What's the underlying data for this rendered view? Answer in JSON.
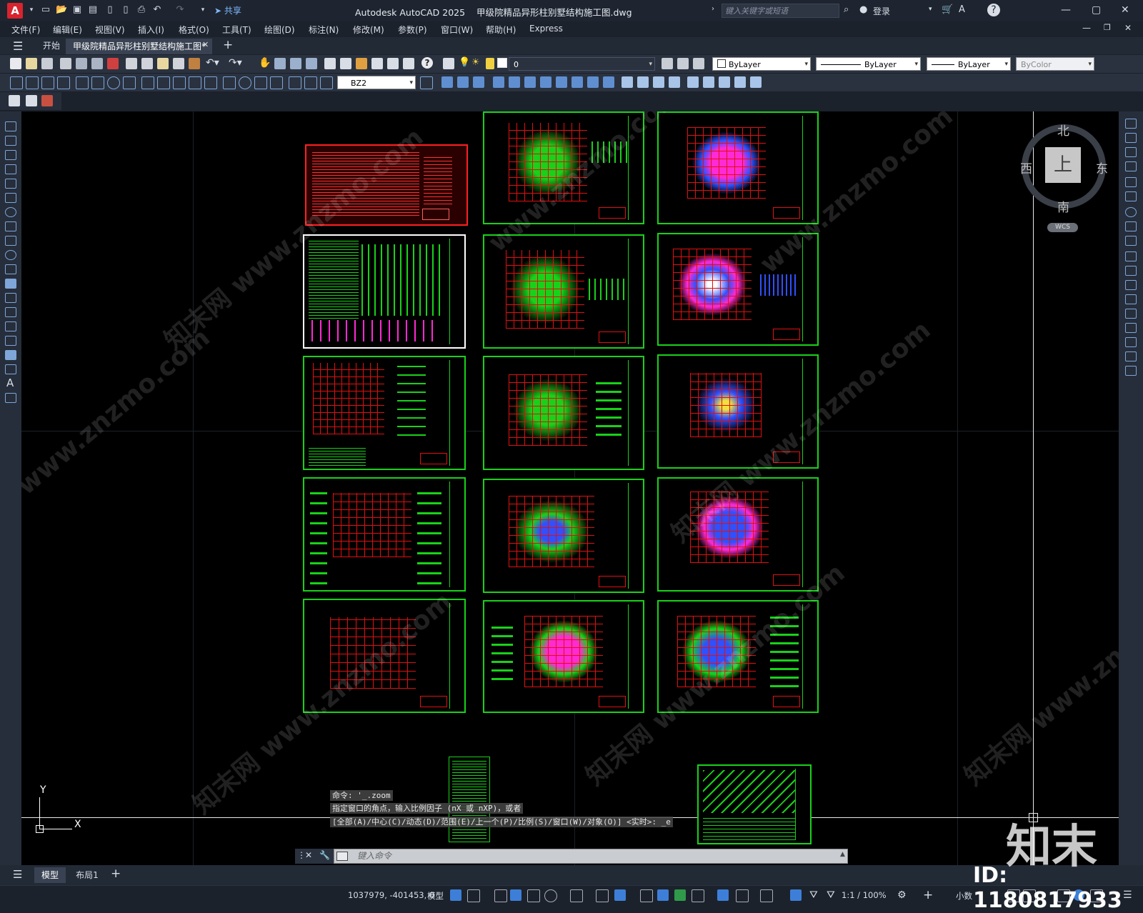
{
  "app": {
    "logo": "A",
    "name": "Autodesk AutoCAD 2025",
    "filename": "甲级院精品异形柱别墅结构施工图.dwg",
    "share_label": "共享",
    "search_placeholder": "键入关键字或短语",
    "login_label": "登录"
  },
  "menu": [
    "文件(F)",
    "编辑(E)",
    "视图(V)",
    "插入(I)",
    "格式(O)",
    "工具(T)",
    "绘图(D)",
    "标注(N)",
    "修改(M)",
    "参数(P)",
    "窗口(W)",
    "帮助(H)",
    "Express"
  ],
  "tabs": {
    "home": "开始",
    "doc": "甲级院精品异形柱别墅结构施工图*"
  },
  "layer_combo": "0",
  "dimstyle_combo": "BZ2",
  "properties": {
    "color": "ByLayer",
    "linetype": "ByLayer",
    "lineweight": "ByLayer",
    "plotstyle": "ByColor"
  },
  "viewcube": {
    "north": "北",
    "south": "南",
    "east": "东",
    "west": "西",
    "top": "上",
    "wcs": "WCS"
  },
  "ucs": {
    "y": "Y",
    "x": "X"
  },
  "command": {
    "history": [
      "命令: '_.zoom",
      "指定窗口的角点，输入比例因子 (nX 或 nXP)，或者",
      "[全部(A)/中心(C)/动态(D)/范围(E)/上一个(P)/比例(S)/窗口(W)/对象(O)] <实时>: _e"
    ],
    "placeholder": "键入命令"
  },
  "layout_tabs": [
    "模型",
    "布局1"
  ],
  "status": {
    "coords": "1037979, -401453, 0",
    "space": "模型",
    "scale": "1:1 / 100%",
    "units": "小数"
  },
  "watermark": {
    "text": "www.znzmo.com",
    "brand": "知末网",
    "logo": "知末",
    "id": "ID: 1180817933"
  }
}
